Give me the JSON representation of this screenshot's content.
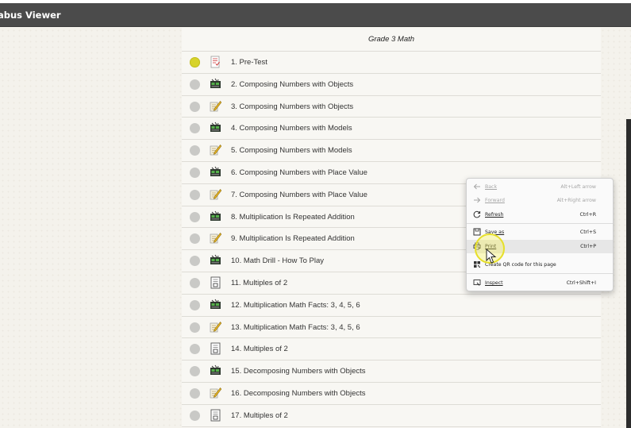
{
  "app": {
    "title": "abus Viewer"
  },
  "list": {
    "heading": "Grade 3 Math",
    "items": [
      {
        "label": "1. Pre-Test",
        "status": "active",
        "icon": "test-document-icon"
      },
      {
        "label": "2. Composing Numbers with Objects",
        "status": "inactive",
        "icon": "video-lesson-icon"
      },
      {
        "label": "3. Composing Numbers with Objects",
        "status": "inactive",
        "icon": "practice-pencil-icon"
      },
      {
        "label": "4. Composing Numbers with Models",
        "status": "inactive",
        "icon": "video-lesson-icon"
      },
      {
        "label": "5. Composing Numbers with Models",
        "status": "inactive",
        "icon": "practice-pencil-icon"
      },
      {
        "label": "6. Composing Numbers with Place Value",
        "status": "inactive",
        "icon": "video-lesson-icon"
      },
      {
        "label": "7. Composing Numbers with Place Value",
        "status": "inactive",
        "icon": "practice-pencil-icon"
      },
      {
        "label": "8. Multiplication Is Repeated Addition",
        "status": "inactive",
        "icon": "video-lesson-icon"
      },
      {
        "label": "9. Multiplication Is Repeated Addition",
        "status": "inactive",
        "icon": "practice-pencil-icon"
      },
      {
        "label": "10. Math Drill - How To Play",
        "status": "inactive",
        "icon": "video-lesson-icon"
      },
      {
        "label": "11. Multiples of 2",
        "status": "inactive",
        "icon": "worksheet-icon"
      },
      {
        "label": "12. Multiplication Math Facts: 3, 4, 5, 6",
        "status": "inactive",
        "icon": "video-lesson-icon"
      },
      {
        "label": "13. Multiplication Math Facts: 3, 4, 5, 6",
        "status": "inactive",
        "icon": "practice-pencil-icon"
      },
      {
        "label": "14. Multiples of 2",
        "status": "inactive",
        "icon": "worksheet-icon"
      },
      {
        "label": "15. Decomposing Numbers with Objects",
        "status": "inactive",
        "icon": "video-lesson-icon"
      },
      {
        "label": "16. Decomposing Numbers with Objects",
        "status": "inactive",
        "icon": "practice-pencil-icon"
      },
      {
        "label": "17. Multiples of 2",
        "status": "inactive",
        "icon": "worksheet-icon"
      }
    ]
  },
  "context_menu": {
    "back": {
      "label": "Back",
      "shortcut": "Alt+Left arrow"
    },
    "forward": {
      "label": "Forward",
      "shortcut": "Alt+Right arrow"
    },
    "refresh": {
      "label": "Refresh",
      "shortcut": "Ctrl+R"
    },
    "save_as": {
      "label": "Save as",
      "shortcut": "Ctrl+S"
    },
    "print": {
      "label": "Print",
      "shortcut": "Ctrl+P"
    },
    "qr": {
      "label": "Create QR code for this page"
    },
    "inspect": {
      "label": "Inspect",
      "shortcut": "Ctrl+Shift+I"
    }
  },
  "colors": {
    "titlebar": "#4b4b4b",
    "active_status": "#d7d32a",
    "inactive_status": "#c9c9c6"
  }
}
